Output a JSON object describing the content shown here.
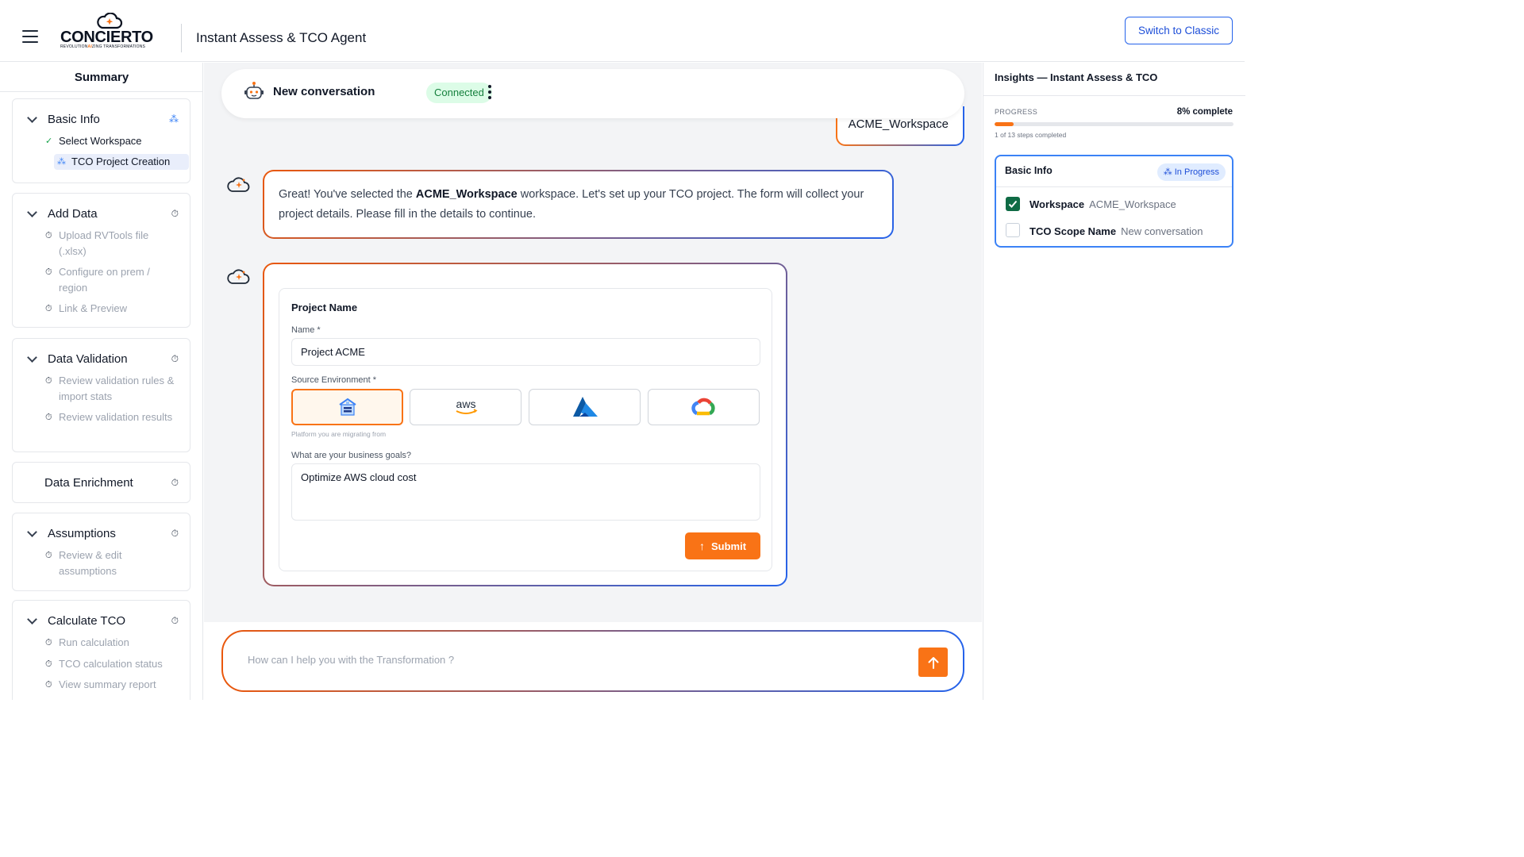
{
  "header": {
    "logo_text": "CONCIERTO",
    "logo_tagline_pre": "REVOLUTION",
    "logo_tagline_mid": "AI",
    "logo_tagline_post": "ZING TRANSFORMATIONS",
    "app_title": "Instant Assess & TCO Agent",
    "switch_button": "Switch to Classic"
  },
  "sidebar": {
    "title": "Summary",
    "sections": [
      {
        "title": "Basic Info",
        "status_icon": "loading-icon",
        "items": [
          {
            "label": "Select Workspace",
            "state": "done"
          },
          {
            "label": "TCO Project Creation",
            "state": "active"
          }
        ]
      },
      {
        "title": "Add Data",
        "status_icon": "timer-icon",
        "items": [
          {
            "label": "Upload RVTools file (.xlsx)",
            "state": "pending"
          },
          {
            "label": "Configure on prem / region",
            "state": "pending"
          },
          {
            "label": "Link & Preview",
            "state": "pending"
          }
        ]
      },
      {
        "title": "Data Validation",
        "status_icon": "timer-icon",
        "items": [
          {
            "label": "Review validation rules & import stats",
            "state": "pending"
          },
          {
            "label": "Review validation results",
            "state": "pending"
          }
        ]
      },
      {
        "title": "Data Enrichment",
        "status_icon": "timer-icon",
        "items": []
      },
      {
        "title": "Assumptions",
        "status_icon": "timer-icon",
        "items": [
          {
            "label": "Review & edit assumptions",
            "state": "pending"
          }
        ]
      },
      {
        "title": "Calculate TCO",
        "status_icon": "timer-icon",
        "items": [
          {
            "label": "Run calculation",
            "state": "pending"
          },
          {
            "label": "TCO calculation status",
            "state": "pending"
          },
          {
            "label": "View summary report",
            "state": "pending"
          }
        ]
      }
    ]
  },
  "conversation": {
    "title": "New conversation",
    "status": "Connected",
    "user_message": "ACME_Workspace",
    "ai_message": {
      "pre": "Great! You've selected the ",
      "bold": "ACME_Workspace",
      "post": " workspace. Let's set up your TCO project. The form will collect your project details. Please fill in the details to continue."
    }
  },
  "form": {
    "heading": "Project Name",
    "name_label": "Name *",
    "name_value": "Project ACME",
    "source_label": "Source Environment *",
    "environments": [
      {
        "name": "On-premises",
        "icon": "datacenter-icon",
        "selected": true
      },
      {
        "name": "aws",
        "icon": "aws-logo",
        "selected": false
      },
      {
        "name": "Azure",
        "icon": "azure-logo",
        "selected": false
      },
      {
        "name": "Google Cloud",
        "icon": "gcp-logo",
        "selected": false
      }
    ],
    "source_hint": "Platform you are migrating from",
    "goals_label": "What are your business goals?",
    "goals_value": "Optimize AWS cloud cost",
    "submit_label": "Submit"
  },
  "prompt": {
    "placeholder": "How can I help you with the Transformation ?"
  },
  "insights": {
    "title": "Insights — Instant Assess & TCO",
    "progress_label": "PROGRESS",
    "progress_percent_text": "8% complete",
    "progress_fraction": 0.08,
    "steps_text": "1 of 13 steps completed",
    "card": {
      "title": "Basic Info",
      "badge": "In Progress",
      "rows": [
        {
          "key": "Workspace",
          "value": "ACME_Workspace",
          "checked": true
        },
        {
          "key": "TCO Scope Name",
          "value": "New conversation",
          "checked": false
        }
      ]
    }
  },
  "colors": {
    "accent_orange": "#f97316",
    "accent_blue": "#2563eb",
    "connected_green": "#15803d",
    "check_green": "#0f6b45"
  }
}
